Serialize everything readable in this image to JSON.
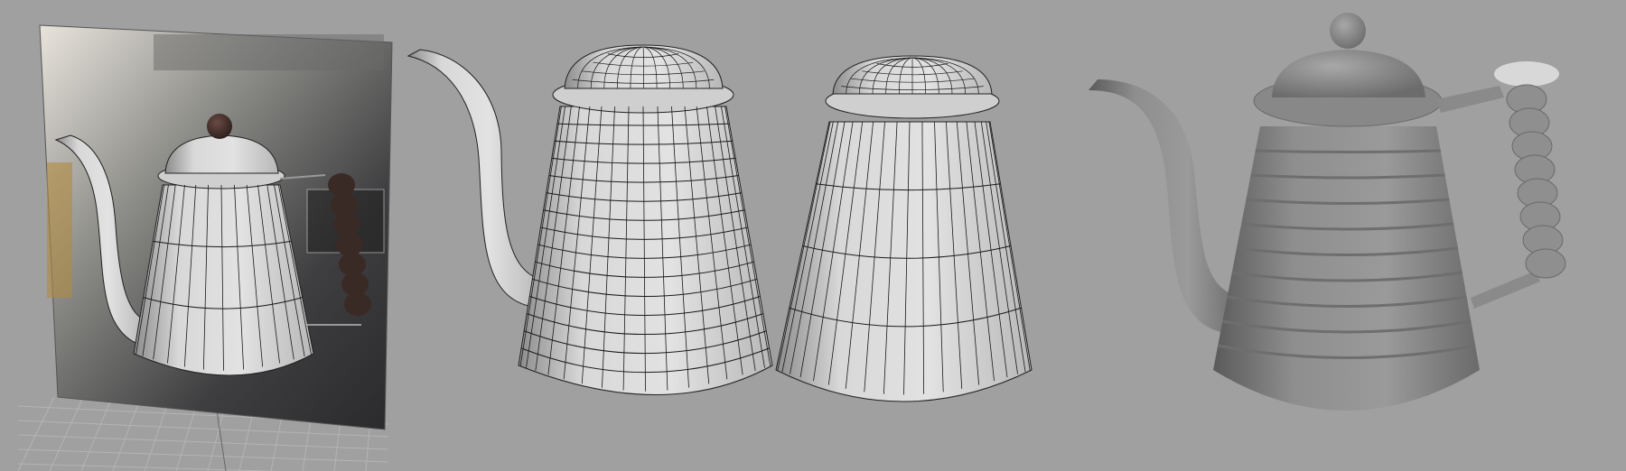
{
  "viewport": {
    "background": "#a0a0a0",
    "models": [
      {
        "id": "reference-teapot",
        "style": "wireframe-on-photo"
      },
      {
        "id": "ribbed-wireframe-teapot",
        "style": "wireframe"
      },
      {
        "id": "plain-body-wireframe",
        "style": "wireframe"
      },
      {
        "id": "shaded-teapot",
        "style": "shaded"
      }
    ],
    "colors": {
      "wire": "#1a1a1a",
      "surface": "#d4d4d4",
      "shaded": "#8a8a8a",
      "handle_wood": "#3a2a26"
    }
  }
}
